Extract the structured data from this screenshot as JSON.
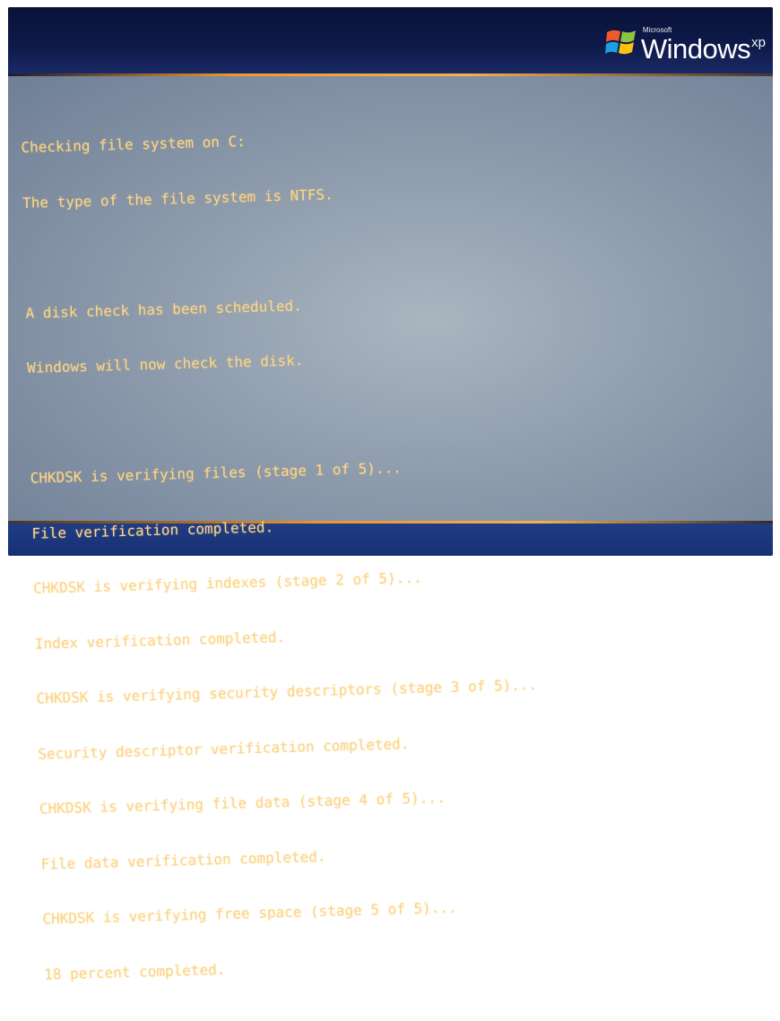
{
  "header": {
    "brand_small": "Microsoft",
    "brand_name": "Windows",
    "brand_version": "xp"
  },
  "console": {
    "lines": [
      "Checking file system on C:",
      "The type of the file system is NTFS.",
      "",
      "A disk check has been scheduled.",
      "Windows will now check the disk.",
      "",
      "CHKDSK is verifying files (stage 1 of 5)...",
      "File verification completed.",
      "CHKDSK is verifying indexes (stage 2 of 5)...",
      "Index verification completed.",
      "CHKDSK is verifying security descriptors (stage 3 of 5)...",
      "Security descriptor verification completed.",
      "CHKDSK is verifying file data (stage 4 of 5)...",
      "File data verification completed.",
      "CHKDSK is verifying free space (stage 5 of 5)...",
      "18 percent completed."
    ]
  },
  "colors": {
    "text": "#fbd58a",
    "header": "#0e1a4a",
    "footer": "#1f3c86",
    "accent_rule": "#f39a2a",
    "background": "#8e9cad"
  },
  "icons": {
    "logo": "windows-flag-icon"
  }
}
